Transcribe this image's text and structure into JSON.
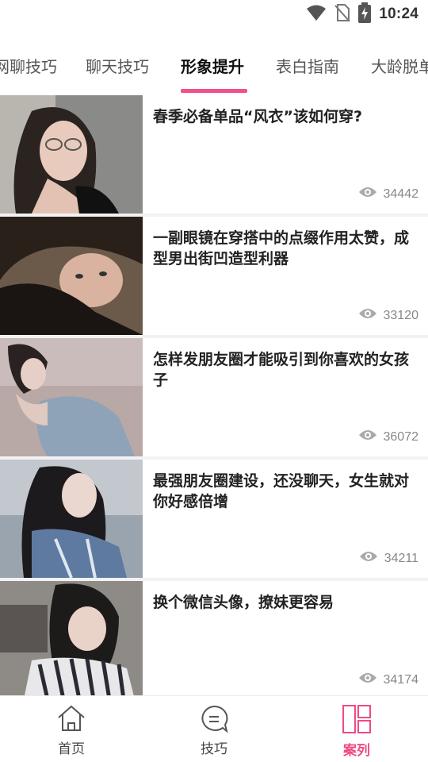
{
  "status_bar": {
    "time": "10:24",
    "icons": [
      "wifi-icon",
      "no-sim-icon",
      "battery-charging-icon"
    ]
  },
  "tabs": [
    {
      "label": "网聊技巧",
      "active": false
    },
    {
      "label": "聊天技巧",
      "active": false
    },
    {
      "label": "形象提升",
      "active": true
    },
    {
      "label": "表白指南",
      "active": false
    },
    {
      "label": "大龄脱单",
      "active": false
    }
  ],
  "articles": [
    {
      "title": "春季必备单品“风衣”该如何穿?",
      "views": "34442"
    },
    {
      "title": "一副眼镜在穿搭中的点缀作用太赞，成型男出街凹造型利器",
      "views": "33120"
    },
    {
      "title": "怎样发朋友圈才能吸引到你喜欢的女孩子",
      "views": "36072"
    },
    {
      "title": "最强朋友圈建设，还没聊天，女生就对你好感倍增",
      "views": "34211"
    },
    {
      "title": "换个微信头像，撩妹更容易",
      "views": "34174"
    }
  ],
  "bottom_nav": [
    {
      "label": "首页",
      "icon": "home-icon",
      "active": false
    },
    {
      "label": "技巧",
      "icon": "chat-icon",
      "active": false
    },
    {
      "label": "案列",
      "icon": "layout-icon",
      "active": true
    }
  ],
  "colors": {
    "accent": "#f0508c",
    "text": "#222222",
    "muted": "#888888"
  }
}
